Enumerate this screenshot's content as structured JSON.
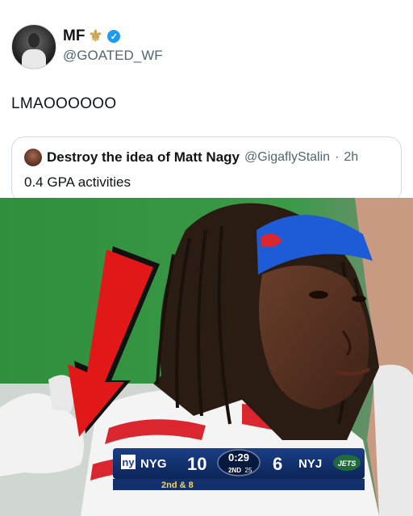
{
  "tweet": {
    "author": {
      "display_name": "MF",
      "handle": "@GOATED_WF",
      "badge_icon": "fleur-de-lis-icon",
      "verified": true
    },
    "text": "LMAOOOOOO"
  },
  "quoted_tweet": {
    "author": {
      "display_name": "Destroy the idea of Matt Nagy",
      "handle": "@GigaflyStalin",
      "separator": "·",
      "time": "2h"
    },
    "text": "0.4 GPA activities"
  },
  "scorebug": {
    "home_abbr": "NYG",
    "home_score": "10",
    "clock": "0:29",
    "quarter": "2ND",
    "play_clock": "25",
    "away_score": "6",
    "away_abbr": "NYJ",
    "down_distance": "2nd & 8"
  },
  "colors": {
    "verified": "#1d9bf0",
    "field_green": "#2e8a3a",
    "headband": "#1e5bd6",
    "arrow": "#e21818",
    "giants_red": "#c8102e"
  }
}
